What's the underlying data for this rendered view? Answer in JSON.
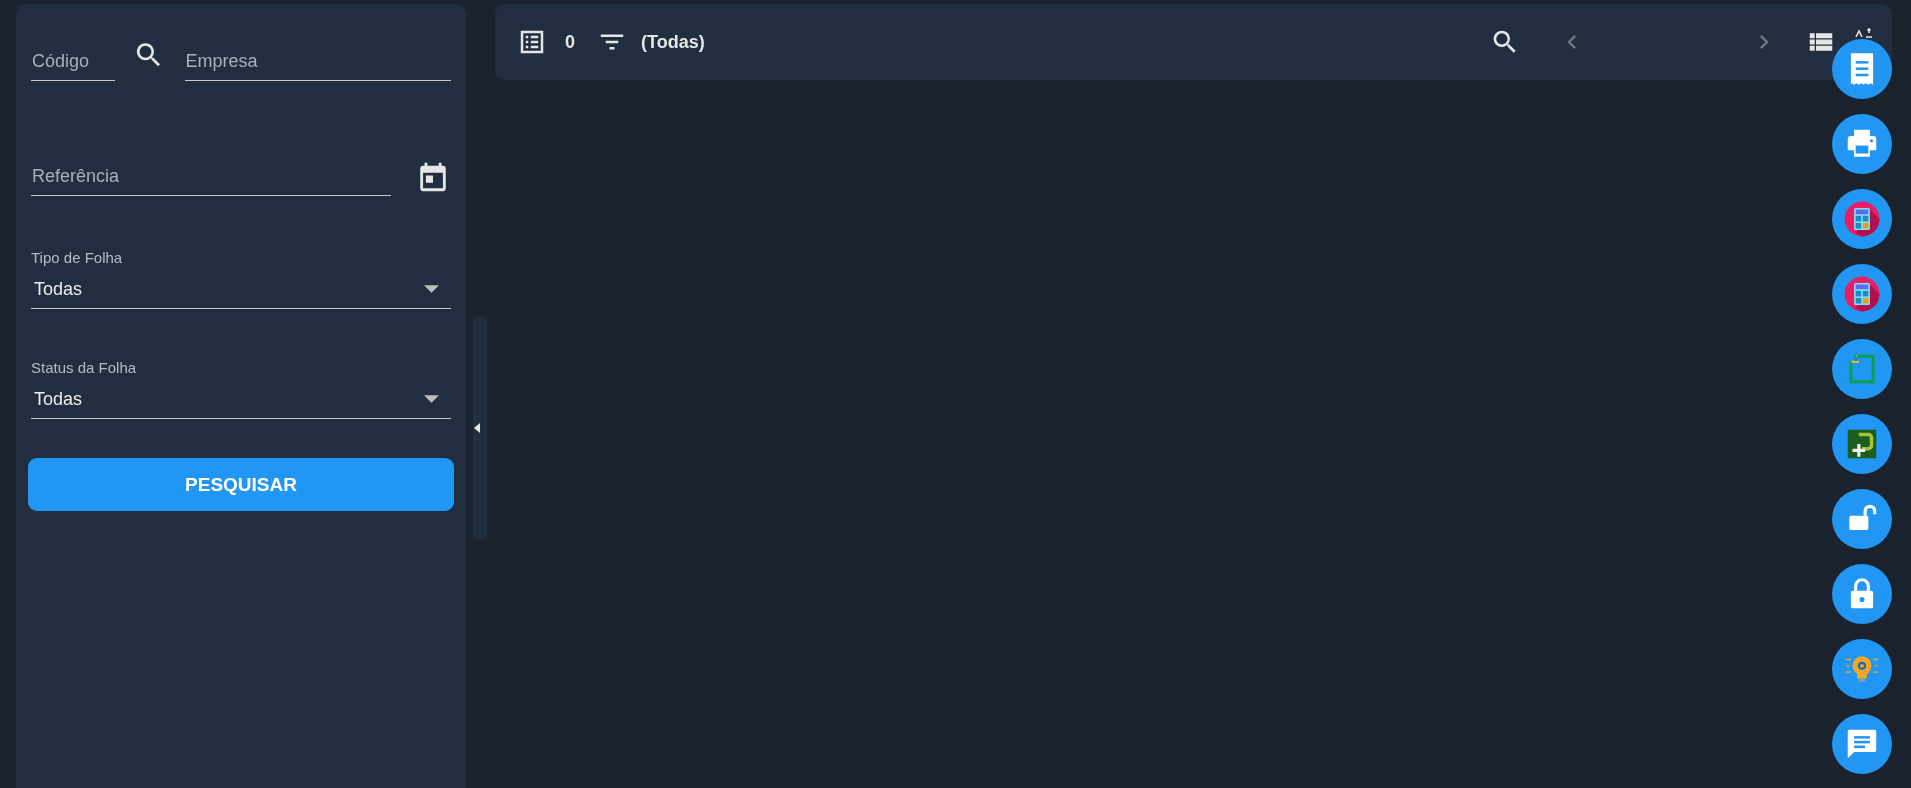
{
  "filters": {
    "code_field": {
      "placeholder": "Código"
    },
    "company_field": {
      "placeholder": "Empresa"
    },
    "reference_field": {
      "placeholder": "Referência"
    },
    "selects": [
      {
        "label": "Tipo de Folha",
        "value": "Todas"
      },
      {
        "label": "Status da Folha",
        "value": "Todas"
      }
    ],
    "search_button": "PESQUISAR"
  },
  "toolbar": {
    "count": "0",
    "filter": "(Todas)",
    "prev": {
      "disabled": true
    },
    "next": {
      "disabled": true
    }
  },
  "fab_buttons": [
    {
      "kind": "receipt"
    },
    {
      "kind": "printer"
    },
    {
      "kind": "calculator"
    },
    {
      "kind": "calculator"
    },
    {
      "kind": "document"
    },
    {
      "kind": "document-plus"
    },
    {
      "kind": "unlock"
    },
    {
      "kind": "lock"
    },
    {
      "kind": "idea"
    },
    {
      "kind": "chat"
    }
  ]
}
